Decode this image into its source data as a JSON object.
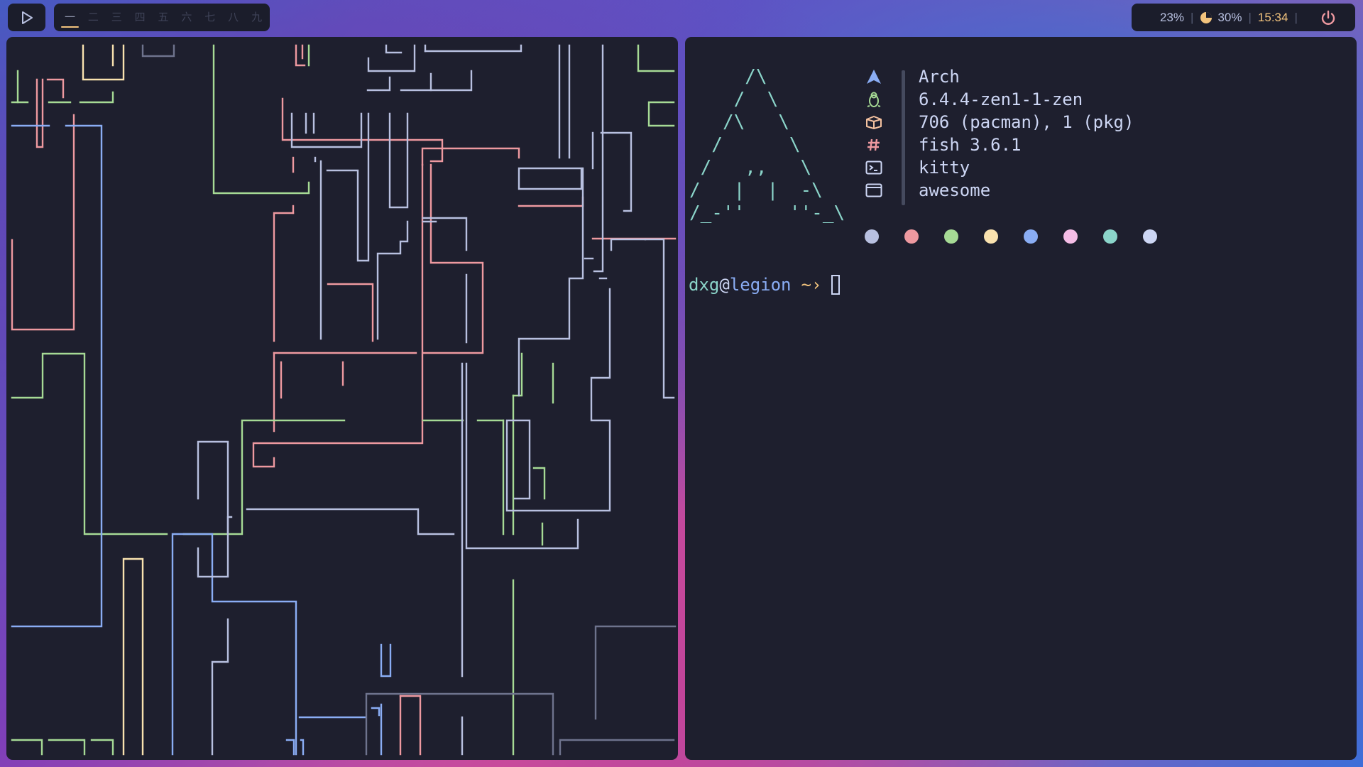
{
  "topbar": {
    "tags": [
      "一",
      "二",
      "三",
      "四",
      "五",
      "六",
      "七",
      "八",
      "九"
    ],
    "active_tag_index": 0,
    "cpu": "23%",
    "memory": "30%",
    "time": "15:34"
  },
  "fetch": {
    "logo_lines": [
      "     /\\     ",
      "    /  \\    ",
      "   /\\   \\   ",
      "  /      \\  ",
      " /   ,,   \\ ",
      "/   |  |  -\\",
      "/_-''    ''-_\\"
    ],
    "rows": [
      {
        "icon": "arch-icon",
        "icon_color": "#8aadf4",
        "value": "Arch"
      },
      {
        "icon": "penguin-icon",
        "icon_color": "#a6da95",
        "value": "6.4.4-zen1-1-zen"
      },
      {
        "icon": "package-icon",
        "icon_color": "#f5c2a0",
        "value": "706 (pacman), 1 (pkg)"
      },
      {
        "icon": "hash-icon",
        "icon_color": "#ee99a0",
        "value": "fish 3.6.1"
      },
      {
        "icon": "terminal-icon",
        "icon_color": "#cdd6f4",
        "value": "kitty"
      },
      {
        "icon": "window-icon",
        "icon_color": "#cdd6f4",
        "value": "awesome"
      }
    ],
    "palette": [
      "#b8c0e0",
      "#ee99a0",
      "#a6da95",
      "#f9e2af",
      "#8aadf4",
      "#f5bde6",
      "#8bd5ca",
      "#cdd6f4"
    ]
  },
  "prompt": {
    "user": "dxg",
    "at": "@",
    "host": "legion",
    "arrow": "~›"
  },
  "pipes": {
    "colors": {
      "pink": "#ee99a0",
      "green": "#a6da95",
      "blue": "#8aadf4",
      "white": "#b8c0e0",
      "yellow": "#f9e2af",
      "gray": "#6e738d"
    }
  }
}
